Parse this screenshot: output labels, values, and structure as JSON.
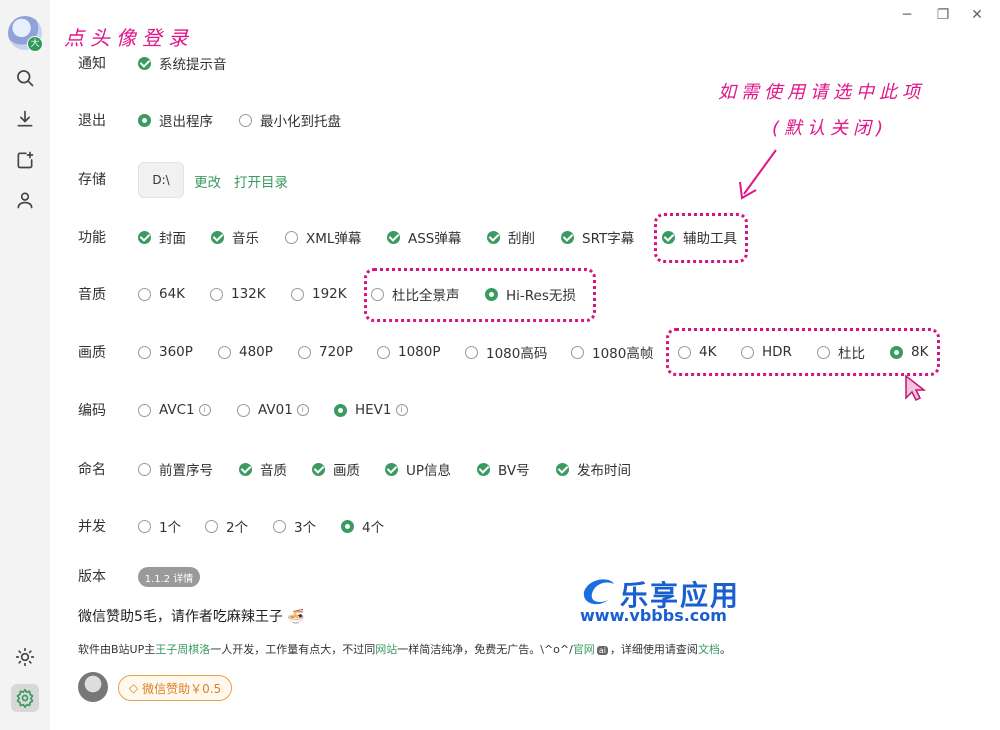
{
  "annotations": {
    "login_hint": "点头像登录",
    "tool_hint_line1": "如需使用请选中此项",
    "tool_hint_line2": "(默认关闭)"
  },
  "avatar_badge": "大",
  "sidebar": {
    "items": [
      "search-icon",
      "download-icon",
      "add-file-icon",
      "user-icon"
    ],
    "bottom": [
      "theme-sun-icon",
      "settings-gear-icon"
    ]
  },
  "window": {
    "minimize": "─",
    "restore": "❐",
    "close": "✕"
  },
  "settings": {
    "notify": {
      "label": "通知",
      "options": [
        {
          "text": "系统提示音",
          "state": "checked"
        }
      ]
    },
    "exit": {
      "label": "退出",
      "options": [
        {
          "text": "退出程序",
          "state": "radio-on"
        },
        {
          "text": "最小化到托盘",
          "state": "off"
        }
      ]
    },
    "storage": {
      "label": "存储",
      "dir": "D:\\",
      "change": "更改",
      "open": "打开目录"
    },
    "features": {
      "label": "功能",
      "options": [
        "封面",
        "音乐",
        "XML弹幕",
        "ASS弹幕",
        "刮削",
        "SRT字幕",
        "辅助工具"
      ]
    },
    "audio": {
      "label": "音质",
      "options": [
        "64K",
        "132K",
        "192K",
        "杜比全景声",
        "Hi-Res无损"
      ]
    },
    "video": {
      "label": "画质",
      "options": [
        "360P",
        "480P",
        "720P",
        "1080P",
        "1080高码",
        "1080高帧",
        "4K",
        "HDR",
        "杜比",
        "8K"
      ]
    },
    "codec": {
      "label": "编码",
      "options": [
        "AVC1",
        "AV01",
        "HEV1"
      ]
    },
    "naming": {
      "label": "命名",
      "options": [
        "前置序号",
        "音质",
        "画质",
        "UP信息",
        "BV号",
        "发布时间"
      ]
    },
    "concurrency": {
      "label": "并发",
      "options": [
        "1个",
        "2个",
        "3个",
        "4个"
      ]
    },
    "version": {
      "label": "版本",
      "badge": "1.1.2 详情"
    }
  },
  "donate_text": "微信赞助5毛，请作者吃麻辣王子",
  "footer": {
    "p1": "软件由B站UP主",
    "author": "王子周棋洛",
    "p2": "一人开发，工作量有点大，不过同",
    "site": "网站",
    "p3": "一样简洁纯净，免费无广告。\\^o^/",
    "official": "官网",
    "badge": "ai",
    "p4": "，详细使用请查阅",
    "docs": "文档",
    "p5": "。"
  },
  "donate_button": "微信赞助￥0.5",
  "watermark": {
    "name": "乐享应用",
    "url": "www.vbbbs.com"
  },
  "colors": {
    "accent": "#3a9a62",
    "annotation": "#e0168a"
  }
}
